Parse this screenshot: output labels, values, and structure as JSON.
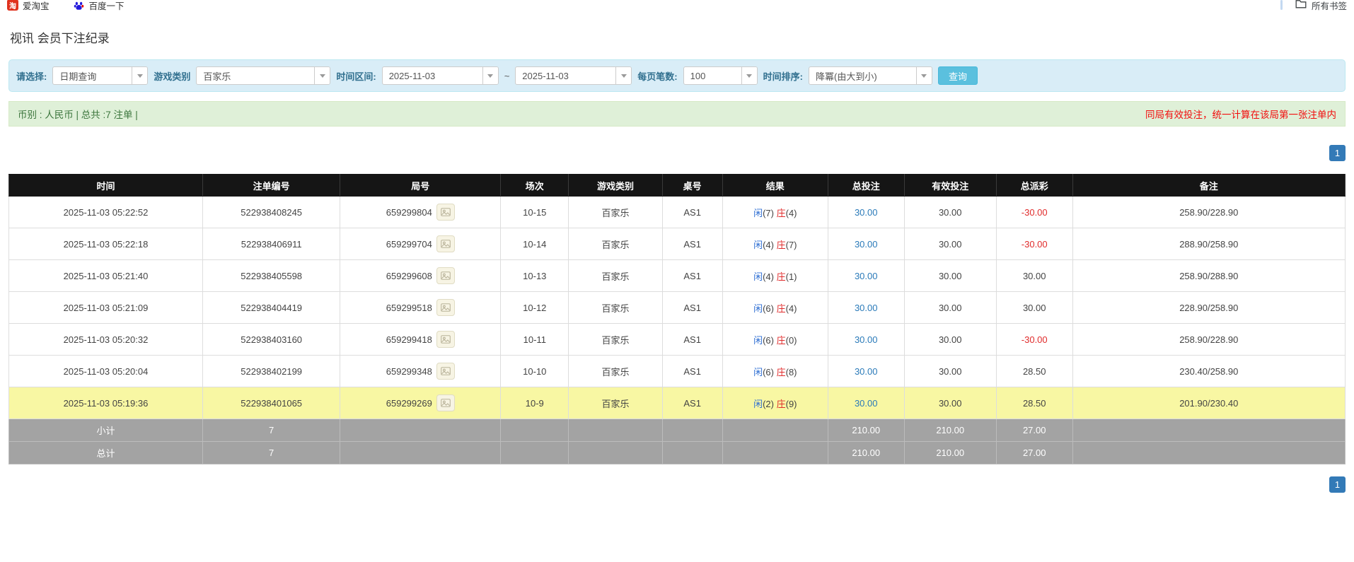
{
  "bookmarks_bar": {
    "items": [
      {
        "label": "爱淘宝",
        "icon": "taobao-icon",
        "glyph": "淘"
      },
      {
        "label": "百度一下",
        "icon": "baidu-icon"
      }
    ],
    "all_bookmarks_label": "所有书签"
  },
  "page": {
    "title": "视讯 会员下注纪录"
  },
  "filters": {
    "query_type": {
      "label": "请选择:",
      "value": "日期查询"
    },
    "game_category": {
      "label": "游戏类别",
      "value": "百家乐"
    },
    "date_range": {
      "label": "时间区间:",
      "from": "2025-11-03",
      "separator": "~",
      "to": "2025-11-03"
    },
    "page_size": {
      "label": "每页笔数:",
      "value": "100"
    },
    "time_sort": {
      "label": "时间排序:",
      "value": "降冪(由大到小)"
    },
    "search_button": "查询"
  },
  "summary": {
    "left": "币别 : 人民币 | 总共 :7 注单 |",
    "right": "同局有效投注，统一计算在该局第一张注单内"
  },
  "pagination": {
    "page": "1"
  },
  "colors": {
    "accent_blue": "#337ab7",
    "panel_blue": "#d9edf7",
    "success_green": "#dff0d8",
    "highlight_yellow": "#f8f7a3",
    "negative_red": "#e02b2b"
  },
  "table": {
    "columns": [
      "时间",
      "注单编号",
      "局号",
      "场次",
      "游戏类别",
      "桌号",
      "结果",
      "总投注",
      "有效投注",
      "总派彩",
      "备注"
    ],
    "col_widths": [
      "14.5%",
      "10.3%",
      "12.0%",
      "5.1%",
      "7.0%",
      "4.5%",
      "7.9%",
      "5.7%",
      "6.9%",
      "5.7%",
      "20.4%"
    ],
    "rows": [
      {
        "time": "2025-11-03 05:22:52",
        "bet_id": "522938408245",
        "round_id": "659299804",
        "session": "10-15",
        "game": "百家乐",
        "table_no": "AS1",
        "player_label": "闲",
        "player_num": "(7)",
        "banker_label": "庄",
        "banker_num": "(4)",
        "total_bet": "30.00",
        "valid_bet": "30.00",
        "payout": "-30.00",
        "note": "258.90/228.90",
        "highlight": false
      },
      {
        "time": "2025-11-03 05:22:18",
        "bet_id": "522938406911",
        "round_id": "659299704",
        "session": "10-14",
        "game": "百家乐",
        "table_no": "AS1",
        "player_label": "闲",
        "player_num": "(4)",
        "banker_label": "庄",
        "banker_num": "(7)",
        "total_bet": "30.00",
        "valid_bet": "30.00",
        "payout": "-30.00",
        "note": "288.90/258.90",
        "highlight": false
      },
      {
        "time": "2025-11-03 05:21:40",
        "bet_id": "522938405598",
        "round_id": "659299608",
        "session": "10-13",
        "game": "百家乐",
        "table_no": "AS1",
        "player_label": "闲",
        "player_num": "(4)",
        "banker_label": "庄",
        "banker_num": "(1)",
        "total_bet": "30.00",
        "valid_bet": "30.00",
        "payout": "30.00",
        "note": "258.90/288.90",
        "highlight": false
      },
      {
        "time": "2025-11-03 05:21:09",
        "bet_id": "522938404419",
        "round_id": "659299518",
        "session": "10-12",
        "game": "百家乐",
        "table_no": "AS1",
        "player_label": "闲",
        "player_num": "(6)",
        "banker_label": "庄",
        "banker_num": "(4)",
        "total_bet": "30.00",
        "valid_bet": "30.00",
        "payout": "30.00",
        "note": "228.90/258.90",
        "highlight": false
      },
      {
        "time": "2025-11-03 05:20:32",
        "bet_id": "522938403160",
        "round_id": "659299418",
        "session": "10-11",
        "game": "百家乐",
        "table_no": "AS1",
        "player_label": "闲",
        "player_num": "(6)",
        "banker_label": "庄",
        "banker_num": "(0)",
        "total_bet": "30.00",
        "valid_bet": "30.00",
        "payout": "-30.00",
        "note": "258.90/228.90",
        "highlight": false
      },
      {
        "time": "2025-11-03 05:20:04",
        "bet_id": "522938402199",
        "round_id": "659299348",
        "session": "10-10",
        "game": "百家乐",
        "table_no": "AS1",
        "player_label": "闲",
        "player_num": "(6)",
        "banker_label": "庄",
        "banker_num": "(8)",
        "total_bet": "30.00",
        "valid_bet": "30.00",
        "payout": "28.50",
        "note": "230.40/258.90",
        "highlight": false
      },
      {
        "time": "2025-11-03 05:19:36",
        "bet_id": "522938401065",
        "round_id": "659299269",
        "session": "10-9",
        "game": "百家乐",
        "table_no": "AS1",
        "player_label": "闲",
        "player_num": "(2)",
        "banker_label": "庄",
        "banker_num": "(9)",
        "total_bet": "30.00",
        "valid_bet": "30.00",
        "payout": "28.50",
        "note": "201.90/230.40",
        "highlight": true
      }
    ],
    "subtotal": {
      "label": "小计",
      "count": "7",
      "total_bet": "210.00",
      "valid_bet": "210.00",
      "payout": "27.00"
    },
    "total": {
      "label": "总计",
      "count": "7",
      "total_bet": "210.00",
      "valid_bet": "210.00",
      "payout": "27.00"
    }
  }
}
